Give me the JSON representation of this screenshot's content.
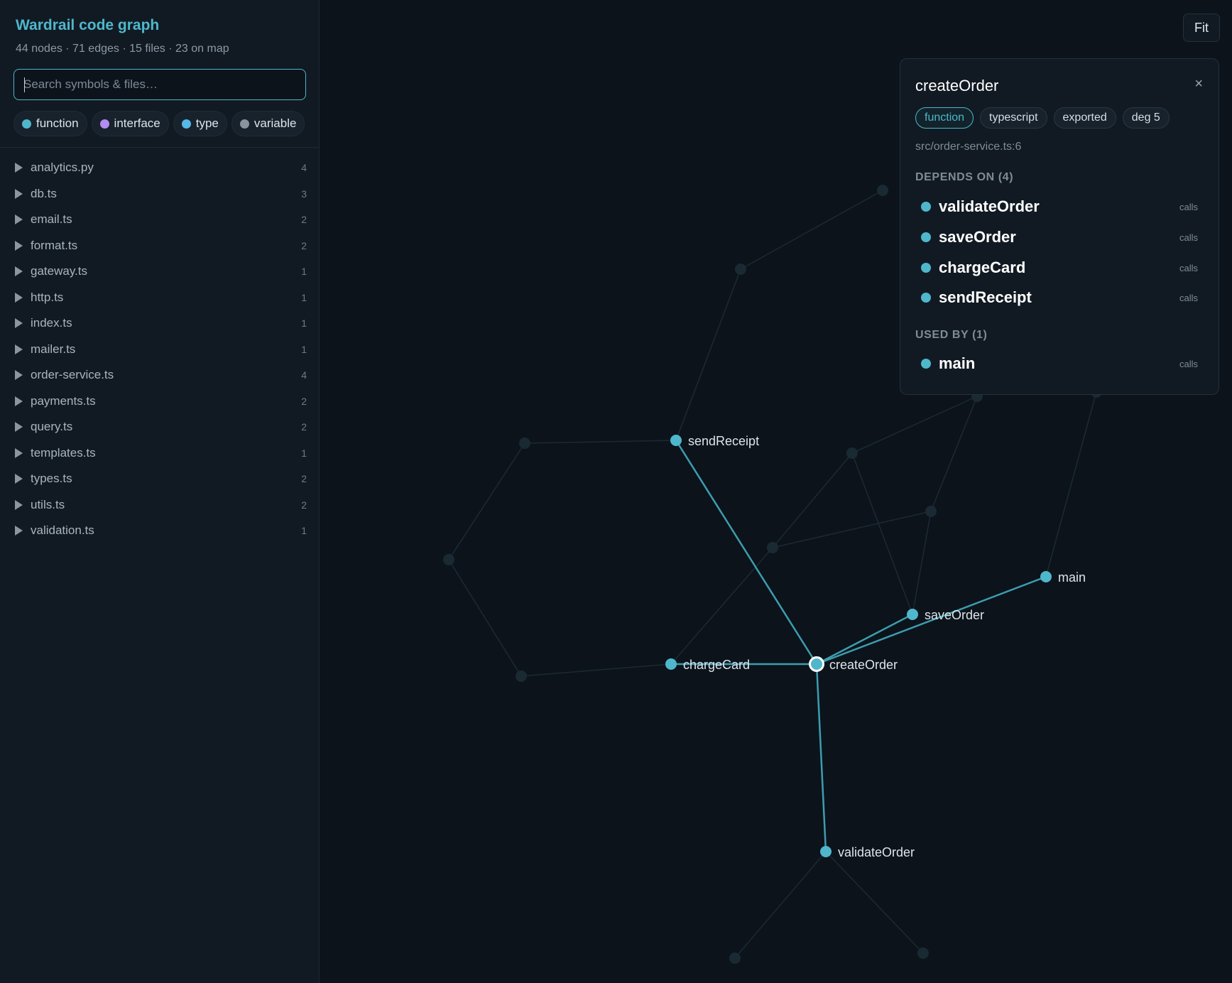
{
  "app": {
    "title": "Wardrail code graph",
    "stats": "44 nodes · 71 edges · 15 files · 23 on map"
  },
  "search": {
    "placeholder": "Search symbols & files…"
  },
  "filters": [
    {
      "label": "function",
      "color": "#4fb7cc"
    },
    {
      "label": "interface",
      "color": "#b58cf0"
    },
    {
      "label": "type",
      "color": "#56b8e6"
    },
    {
      "label": "variable",
      "color": "#8a94a0"
    }
  ],
  "files": [
    {
      "name": "analytics.py",
      "count": "4"
    },
    {
      "name": "db.ts",
      "count": "3"
    },
    {
      "name": "email.ts",
      "count": "2"
    },
    {
      "name": "format.ts",
      "count": "2"
    },
    {
      "name": "gateway.ts",
      "count": "1"
    },
    {
      "name": "http.ts",
      "count": "1"
    },
    {
      "name": "index.ts",
      "count": "1"
    },
    {
      "name": "mailer.ts",
      "count": "1"
    },
    {
      "name": "order-service.ts",
      "count": "4"
    },
    {
      "name": "payments.ts",
      "count": "2"
    },
    {
      "name": "query.ts",
      "count": "2"
    },
    {
      "name": "templates.ts",
      "count": "1"
    },
    {
      "name": "types.ts",
      "count": "2"
    },
    {
      "name": "utils.ts",
      "count": "2"
    },
    {
      "name": "validation.ts",
      "count": "1"
    }
  ],
  "toolbar": {
    "fit_label": "Fit"
  },
  "detail": {
    "title": "createOrder",
    "close": "×",
    "tags": [
      "function",
      "typescript",
      "exported",
      "deg 5"
    ],
    "path": "src/order-service.ts:6",
    "depends_title": "DEPENDS ON (4)",
    "depends": [
      {
        "name": "validateOrder",
        "rel": "calls"
      },
      {
        "name": "saveOrder",
        "rel": "calls"
      },
      {
        "name": "chargeCard",
        "rel": "calls"
      },
      {
        "name": "sendReceipt",
        "rel": "calls"
      }
    ],
    "usedby_title": "USED BY (1)",
    "usedby": [
      {
        "name": "main",
        "rel": "calls"
      }
    ]
  },
  "graph": {
    "accent": "#3d9dae",
    "labels": {
      "createOrder": "createOrder",
      "sendReceipt": "sendReceipt",
      "chargeCard": "chargeCard",
      "saveOrder": "saveOrder",
      "main": "main",
      "validateOrder": "validateOrder"
    }
  }
}
